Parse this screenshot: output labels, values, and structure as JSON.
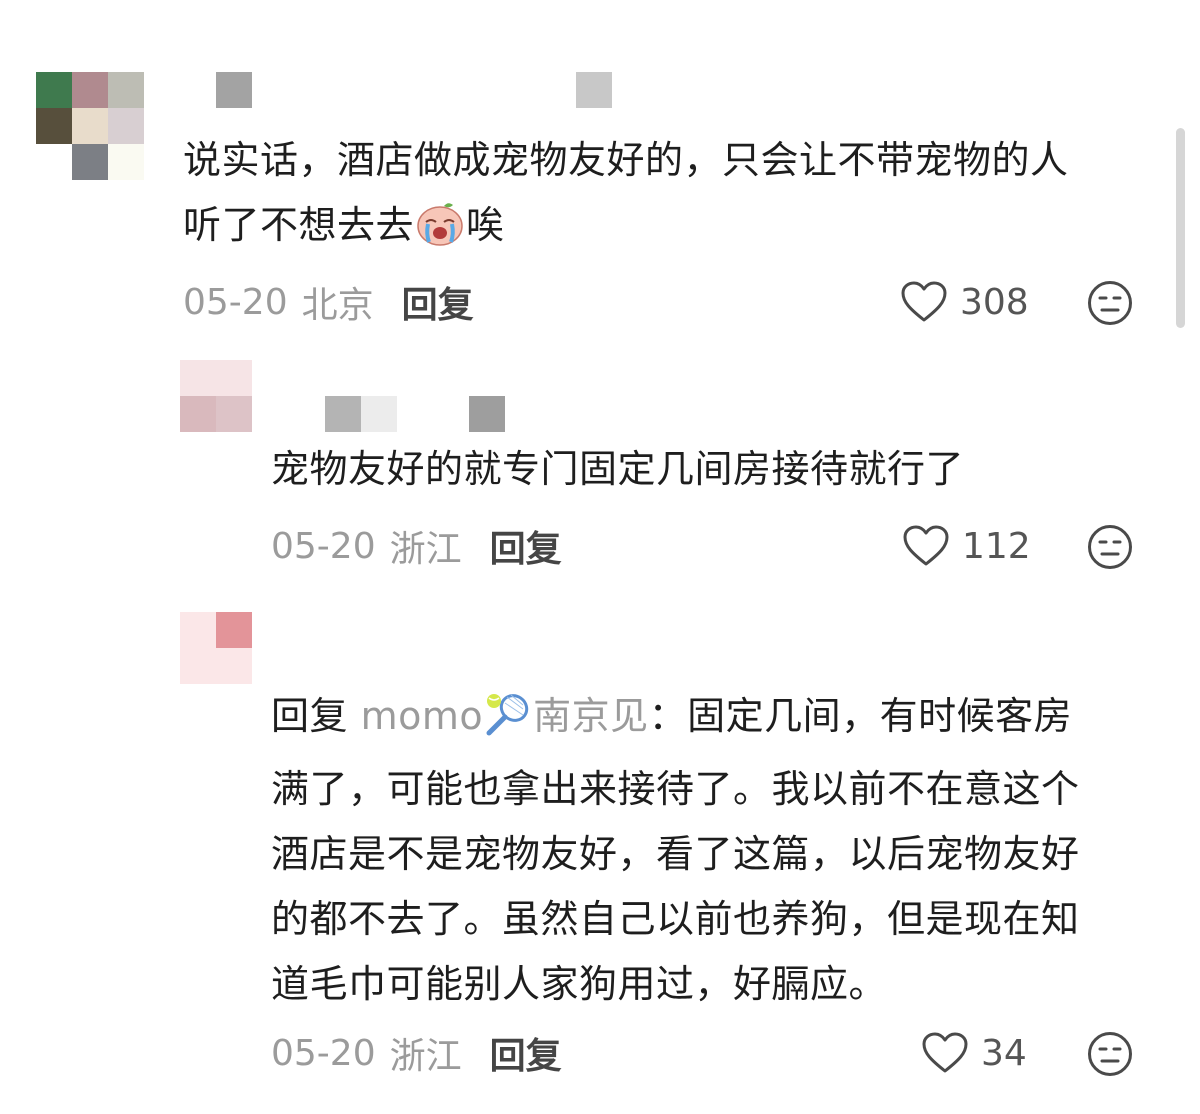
{
  "comments": [
    {
      "text_line1": "说实话，酒店做成宠物友好的，只会让不带宠物的人",
      "text_line2_a": "听了不想去去",
      "text_line2_b": "唉",
      "date": "05-20",
      "location": "北京",
      "reply_label": "回复",
      "likes": "308",
      "emoji": "crying-face"
    },
    {
      "text": "宠物友好的就专门固定几间房接待就行了",
      "date": "05-20",
      "location": "浙江",
      "reply_label": "回复",
      "likes": "112"
    },
    {
      "reply_prefix": "回复",
      "reply_to_a": "momo",
      "reply_to_b": "南京见",
      "reply_colon": "：",
      "line1": "固定几间，有时候客房",
      "line2": "满了，可能也拿出来接待了。我以前不在意这个",
      "line3": "酒店是不是宠物友好，看了这篇，以后宠物友好",
      "line4": "的都不去了。虽然自己以前也养狗，但是现在知",
      "line5": "道毛巾可能别人家狗用过，好膈应。",
      "date": "05-20",
      "location": "浙江",
      "reply_label": "回复",
      "likes": "34",
      "emoji": "tennis-racket"
    }
  ],
  "colors": {
    "text": "#1e1e1e",
    "meta": "#9b9b9b",
    "reply": "#454545"
  }
}
